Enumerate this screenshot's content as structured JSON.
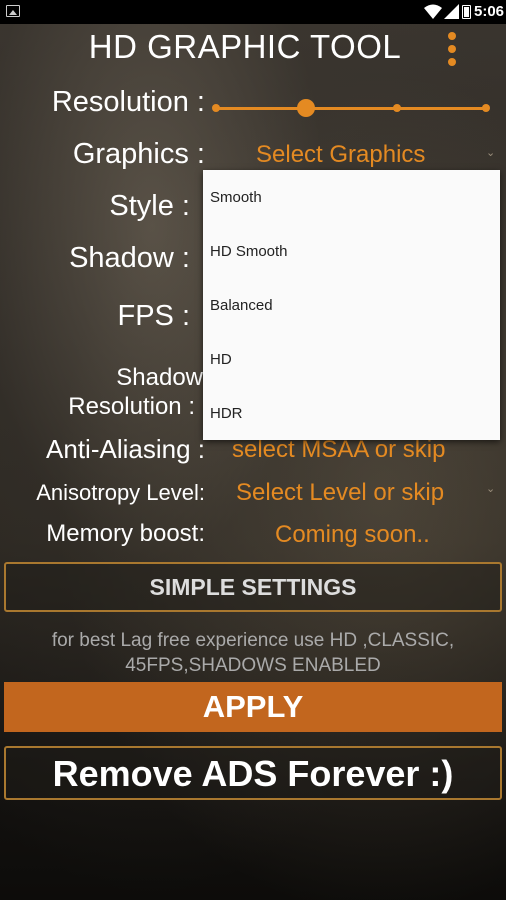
{
  "status_bar": {
    "time": "5:06",
    "icons": [
      "image-icon",
      "wifi-icon",
      "signal-icon",
      "battery-icon"
    ]
  },
  "app": {
    "title": "HD GRAPHIC TOOL",
    "accent_color": "#e48a22"
  },
  "settings": {
    "resolution": {
      "label": "Resolution :",
      "slider_steps": 4,
      "selected_step": 2
    },
    "graphics": {
      "label": "Graphics :",
      "value": "Select Graphics"
    },
    "style": {
      "label": "Style :"
    },
    "shadow": {
      "label": "Shadow :"
    },
    "fps": {
      "label": "FPS :"
    },
    "shadow_resolution": {
      "label_line1": "Shadow",
      "label_line2": "Resolution :"
    },
    "anti_aliasing": {
      "label": "Anti-Aliasing :",
      "value": "select MSAA or skip"
    },
    "anisotropy": {
      "label": "Anisotropy Level:",
      "value": "Select Level or skip"
    },
    "memory_boost": {
      "label": "Memory boost:",
      "value": "Coming soon.."
    }
  },
  "graphics_dropdown": {
    "options": [
      "Smooth",
      "HD Smooth",
      "Balanced",
      "HD",
      "HDR"
    ]
  },
  "buttons": {
    "simple_settings": "SIMPLE SETTINGS",
    "apply": "APPLY",
    "remove_ads": "Remove ADS Forever :)"
  },
  "hint": {
    "line1": "for best Lag free experience use HD ,CLASSIC,",
    "line2": "45FPS,SHADOWS ENABLED"
  }
}
